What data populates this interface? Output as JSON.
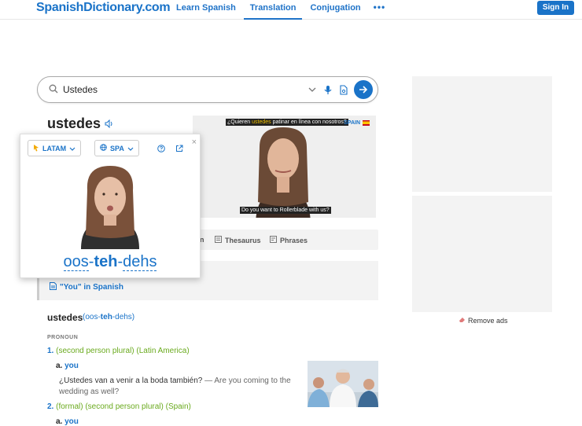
{
  "header": {
    "logo": "SpanishDictionary.com",
    "nav": [
      {
        "label": "Learn Spanish"
      },
      {
        "label": "Translation"
      },
      {
        "label": "Conjugation"
      }
    ],
    "more": "•••",
    "signin": "Sign In"
  },
  "search": {
    "value": "Ustedes"
  },
  "headword": "ustedes",
  "video": {
    "caption_top_before": "¿Quieren ",
    "caption_top_highlight": "ustedes",
    "caption_top_after": " patinar en línea con nosotros?",
    "caption_bottom": "Do you want to Rollerblade with us?",
    "region": "SPAIN"
  },
  "tabs": [
    {
      "label": "n"
    },
    {
      "label": "Thesaurus"
    },
    {
      "label": "Phrases"
    }
  ],
  "translations_link": "\"You\" in Spanish",
  "popup": {
    "region": "LATAM",
    "language": "SPA",
    "close": "×",
    "syl1": "oos",
    "sep1": "-",
    "syl2": "teh",
    "sep2": "-",
    "syl3": "dehs"
  },
  "entry": {
    "word": "ustedes",
    "pron_open": "(oos-",
    "pron_stress": "teh",
    "pron_close": "-dehs)",
    "pos": "PRONOUN",
    "senses": [
      {
        "num": "1.",
        "text": "(second person plural) (Latin America)",
        "sub_letter": "a.",
        "sub_tr": "you"
      },
      {
        "num": "2.",
        "text": "(formal) (second person plural) (Spain)",
        "sub_letter": "a.",
        "sub_tr": "you"
      }
    ],
    "example_es": "¿Ustedes van a venir a la boda también?",
    "example_sep": "—",
    "example_en": "Are you coming to the wedding as well?"
  },
  "ads": {
    "remove": "Remove ads"
  },
  "colors": {
    "brand": "#1a73c8",
    "green": "#6aaa1e"
  }
}
